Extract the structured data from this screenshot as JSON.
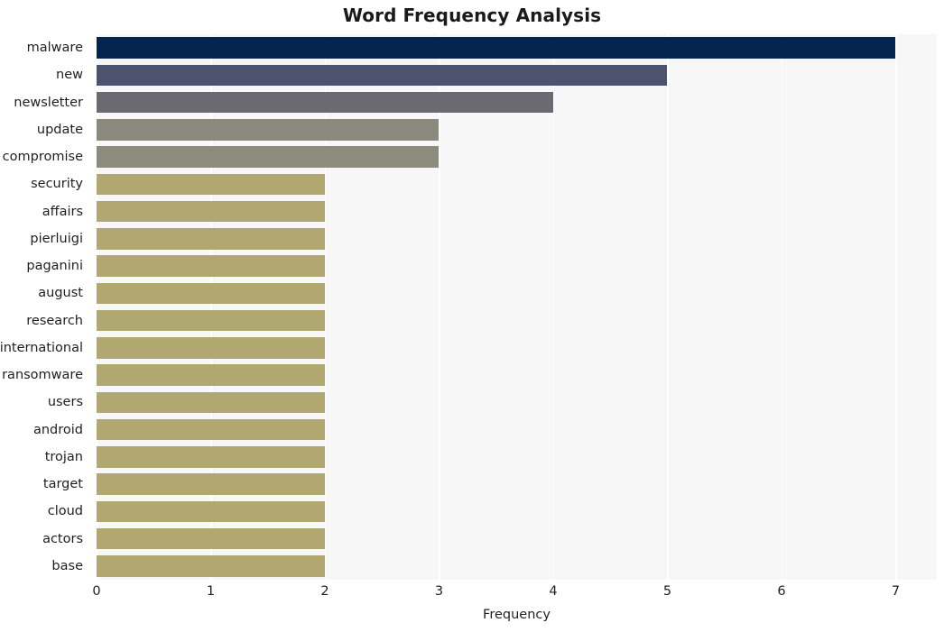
{
  "chart_data": {
    "type": "bar",
    "orientation": "horizontal",
    "title": "Word Frequency Analysis",
    "xlabel": "Frequency",
    "ylabel": "",
    "xlim": [
      0,
      7.36
    ],
    "xticks": [
      0,
      1,
      2,
      3,
      4,
      5,
      6,
      7
    ],
    "xtick_labels": [
      "0",
      "1",
      "2",
      "3",
      "4",
      "5",
      "6",
      "7"
    ],
    "grid": true,
    "grid_axis": "x",
    "legend": false,
    "categories": [
      "malware",
      "new",
      "newsletter",
      "update",
      "compromise",
      "security",
      "affairs",
      "pierluigi",
      "paganini",
      "august",
      "research",
      "international",
      "ransomware",
      "users",
      "android",
      "trojan",
      "target",
      "cloud",
      "actors",
      "base"
    ],
    "values": [
      7,
      5,
      4,
      3,
      3,
      2,
      2,
      2,
      2,
      2,
      2,
      2,
      2,
      2,
      2,
      2,
      2,
      2,
      2,
      2
    ],
    "bar_colors": [
      "#04254d",
      "#4c536e",
      "#6a6b72",
      "#8b8a7d",
      "#8c8b7e",
      "#b1a771",
      "#b1a771",
      "#b1a771",
      "#b1a771",
      "#b1a771",
      "#b1a771",
      "#b1a771",
      "#b1a771",
      "#b1a771",
      "#b1a771",
      "#b1a771",
      "#b1a771",
      "#b1a771",
      "#b1a771",
      "#b1a771"
    ]
  },
  "style": {
    "plot_background": "#f7f7f7",
    "figure_background": "#ffffff",
    "gridline_color": "#ffffff",
    "text_color": "#1f1f1f",
    "title_color": "#1a1a1a"
  }
}
